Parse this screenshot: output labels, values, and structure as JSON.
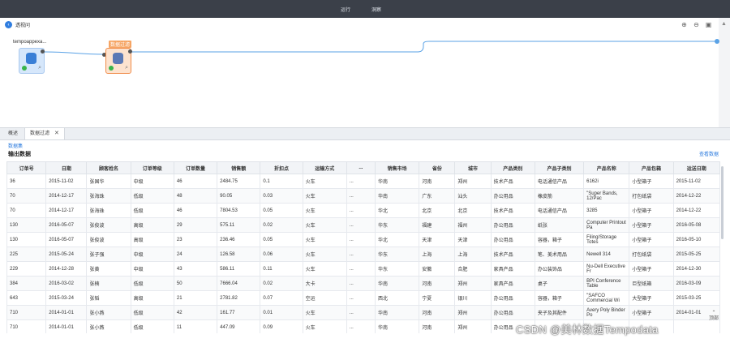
{
  "topbar": {
    "tabs": [
      "运行",
      "洞察"
    ]
  },
  "subheader": {
    "back_label": "透视问"
  },
  "flow": {
    "source_node": {
      "title": "tempoappexa..."
    },
    "filter_node": {
      "title": "数据过滤"
    }
  },
  "panel": {
    "tabs": [
      "概述",
      "数据过滤"
    ],
    "dataset_link": "数据集",
    "output_title": "输出数据",
    "view_data_link": "查看数据"
  },
  "table": {
    "headers": [
      "订单号",
      "日期",
      "顾客姓名",
      "订单等级",
      "订单数量",
      "销售额",
      "折扣点",
      "运输方式",
      "...",
      "销售市场",
      "省份",
      "城市",
      "产品类别",
      "产品子类别",
      "产品名称",
      "产品包箱",
      "运送日期"
    ],
    "rows": [
      [
        "36",
        "2015-11-02",
        "张国华",
        "中级",
        "46",
        "2484.75",
        "0.1",
        "火车",
        "...",
        "华南",
        "河南",
        "郑州",
        "技术产品",
        "电话通信产品",
        "6162i",
        "小型箱子",
        "2015-11-02"
      ],
      [
        "70",
        "2014-12-17",
        "张海珠",
        "低级",
        "48",
        "90.05",
        "0.03",
        "火车",
        "...",
        "华南",
        "广东",
        "汕头",
        "办公用品",
        "橡皮筋",
        "\"Super Bands, 12/Pac",
        "打包纸袋",
        "2014-12-22"
      ],
      [
        "70",
        "2014-12-17",
        "张海珠",
        "低级",
        "46",
        "7804.53",
        "0.05",
        "火车",
        "...",
        "华北",
        "北京",
        "北京",
        "技术产品",
        "电话通信产品",
        "3285",
        "小型箱子",
        "2014-12-22"
      ],
      [
        "130",
        "2016-05-07",
        "张俊波",
        "高级",
        "29",
        "575.11",
        "0.02",
        "火车",
        "...",
        "华东",
        "福建",
        "福州",
        "办公用品",
        "纸张",
        "Computer Printout Pa",
        "小型箱子",
        "2016-05-08"
      ],
      [
        "130",
        "2016-05-07",
        "张俊波",
        "高级",
        "23",
        "236.46",
        "0.05",
        "火车",
        "...",
        "华北",
        "天津",
        "天津",
        "办公用品",
        "容器，箱子",
        "Filing/Storage Totes",
        "小型箱子",
        "2016-05-10"
      ],
      [
        "225",
        "2015-05-24",
        "张子强",
        "中级",
        "24",
        "126.58",
        "0.06",
        "火车",
        "...",
        "华东",
        "上海",
        "上海",
        "技术产品",
        "笔、美术用品",
        "Newell 314",
        "打包纸袋",
        "2015-05-25"
      ],
      [
        "229",
        "2014-12-28",
        "张黄",
        "中级",
        "43",
        "586.11",
        "0.11",
        "火车",
        "...",
        "华东",
        "安徽",
        "合肥",
        "家具产品",
        "办公装饰品",
        "Nu-Dell Executive Fr",
        "小型箱子",
        "2014-12-30"
      ],
      [
        "384",
        "2016-03-02",
        "张楠",
        "低级",
        "50",
        "7666.04",
        "0.02",
        "大卡",
        "...",
        "华南",
        "河南",
        "郑州",
        "家具产品",
        "桌子",
        "BPI Conference Table",
        "巨型纸箱",
        "2016-03-09"
      ],
      [
        "643",
        "2015-03-24",
        "张韬",
        "高级",
        "21",
        "2781.82",
        "0.07",
        "空运",
        "...",
        "西北",
        "宁夏",
        "银川",
        "办公用品",
        "容器，箱子",
        "\"SAFCO Commercial Wi",
        "大型箱子",
        "2015-03-25"
      ],
      [
        "710",
        "2014-01-01",
        "张小燕",
        "低级",
        "42",
        "161.77",
        "0.01",
        "火车",
        "...",
        "华南",
        "河南",
        "郑州",
        "办公用品",
        "夹子及其配件",
        "Avery Poly Binder Po",
        "小型箱子",
        "2014-01-01"
      ],
      [
        "710",
        "2014-01-01",
        "张小燕",
        "低级",
        "11",
        "447.09",
        "0.09",
        "火车",
        "...",
        "华南",
        "河南",
        "郑州",
        "办公用品",
        "",
        "",
        "",
        ""
      ]
    ]
  },
  "back_to_top_label": "顶部",
  "watermark": "CSDN @美林数据Tempodata"
}
